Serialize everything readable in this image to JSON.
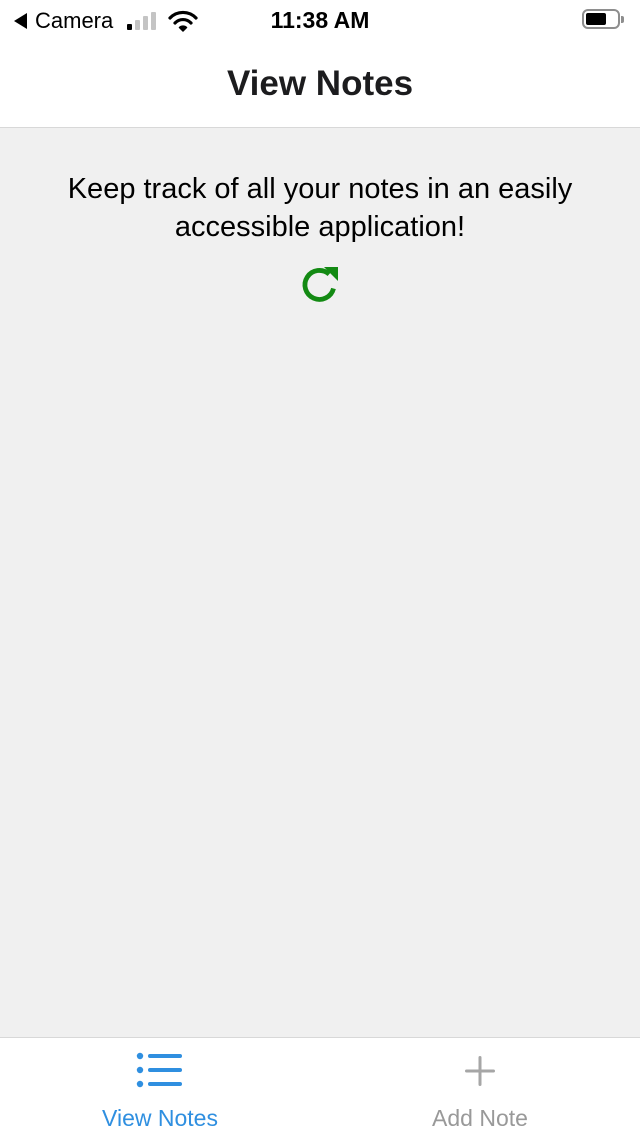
{
  "status_bar": {
    "back_app": "Camera",
    "time": "11:38 AM",
    "signal_bars_on": 1,
    "signal_bars_total": 4,
    "battery_level": 0.55,
    "icons": [
      "back-caret-icon",
      "signal-icon",
      "wifi-icon",
      "battery-icon"
    ]
  },
  "nav": {
    "title": "View Notes"
  },
  "main": {
    "tagline": "Keep track of all your notes in an easily accessible application!",
    "refresh_icon": "refresh-icon",
    "refresh_color": "#138a13",
    "background": "#f0f0f0"
  },
  "tabs": [
    {
      "label": "View Notes",
      "icon": "list-icon",
      "active": true,
      "color": "#2f8fe0"
    },
    {
      "label": "Add Note",
      "icon": "plus-icon",
      "active": false,
      "color": "#999999"
    }
  ]
}
